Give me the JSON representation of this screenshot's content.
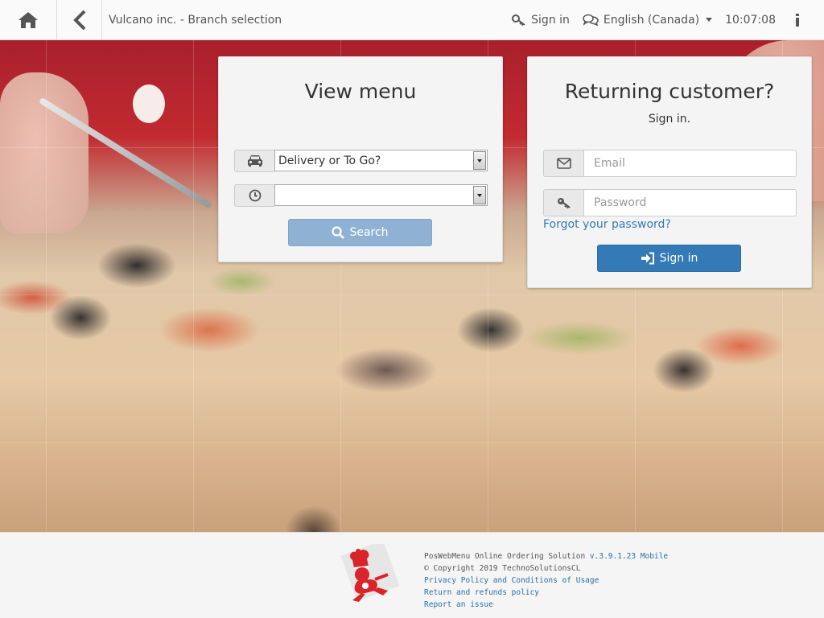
{
  "header": {
    "title": "Vulcano inc. - Branch selection",
    "sign_in": "Sign in",
    "language": "English (Canada)",
    "clock": "10:07:08"
  },
  "menu_panel": {
    "title": "View menu",
    "order_type_value": "Delivery or To Go?",
    "time_value": "",
    "search_label": "Search"
  },
  "login_panel": {
    "title": "Returning customer?",
    "subtitle": "Sign in.",
    "email_placeholder": "Email",
    "password_placeholder": "Password",
    "forgot_label": "Forgot your password?",
    "signin_label": "Sign in"
  },
  "footer": {
    "product": "PosWebMenu Online Ordering Solution",
    "version": "v.3.9.1.23 Mobile",
    "copyright": "© Copyright 2019 TechnoSolutionsCL",
    "privacy": "Privacy Policy and Conditions of Usage",
    "refunds": "Return and refunds policy",
    "report": "Report an issue"
  },
  "colors": {
    "primary": "#337ab7",
    "primary_disabled": "#8fb2d4",
    "logo_red": "#d9252a"
  },
  "icons": [
    "home-icon",
    "back-chevron-icon",
    "key-icon",
    "chat-bubbles-icon",
    "info-icon",
    "car-icon",
    "clock-icon",
    "search-icon",
    "envelope-icon",
    "sign-in-icon"
  ]
}
